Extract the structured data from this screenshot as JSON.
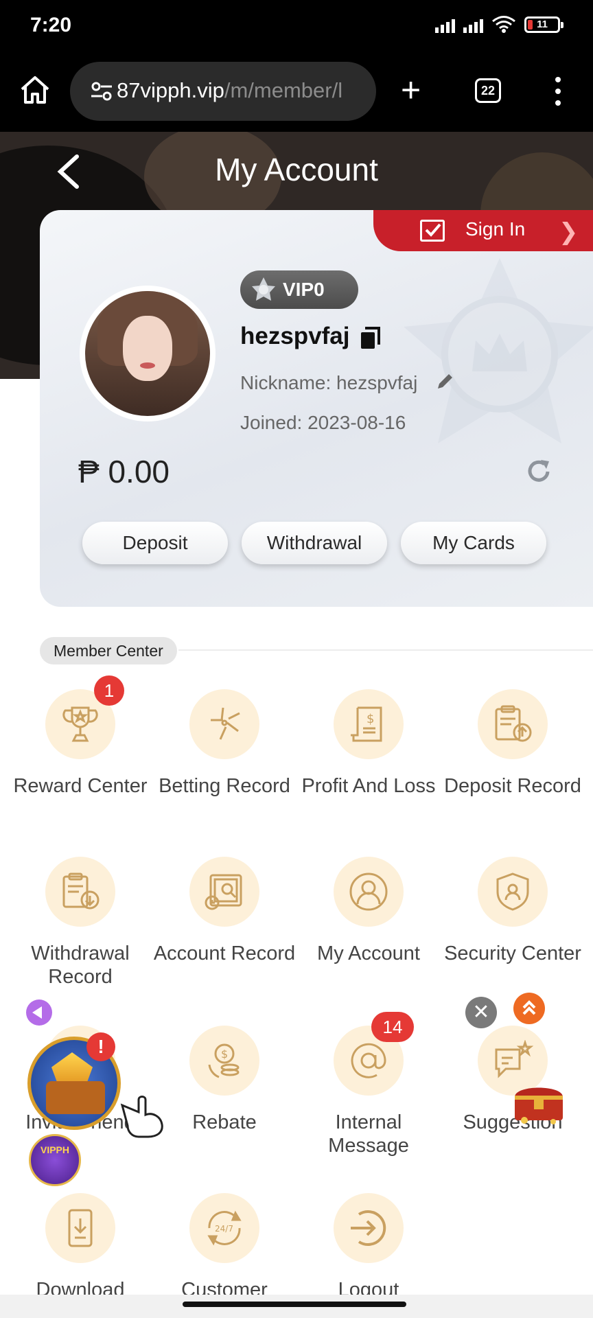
{
  "status_bar": {
    "time": "7:20",
    "battery": "11"
  },
  "browser": {
    "url_domain": "87vipph.vip",
    "url_path": "/m/member/l",
    "tab_count": "22"
  },
  "page": {
    "title": "My Account"
  },
  "account": {
    "sign_in_label": "Sign In",
    "vip_level": "VIP0",
    "username": "hezspvfaj",
    "nickname_label": "Nickname:",
    "nickname": "hezspvfaj",
    "joined_label": "Joined:",
    "joined_date": "2023-08-16",
    "balance": "₱ 0.00",
    "actions": {
      "deposit": "Deposit",
      "withdrawal": "Withdrawal",
      "my_cards": "My Cards"
    }
  },
  "member_center": {
    "title": "Member Center",
    "items": [
      {
        "label": "Reward Center",
        "icon": "trophy-icon",
        "badge": "1"
      },
      {
        "label": "Betting Record",
        "icon": "betting-icon"
      },
      {
        "label": "Profit And Loss",
        "icon": "receipt-icon"
      },
      {
        "label": "Deposit Record",
        "icon": "clipboard-upload-icon"
      },
      {
        "label": "Withdrawal Record",
        "icon": "clipboard-download-icon"
      },
      {
        "label": "Account Record",
        "icon": "ledger-icon"
      },
      {
        "label": "My Account",
        "icon": "user-icon"
      },
      {
        "label": "Security Center",
        "icon": "shield-user-icon"
      },
      {
        "label": "Invite Friend",
        "icon": "invite-icon"
      },
      {
        "label": "Rebate",
        "icon": "coins-icon"
      },
      {
        "label": "Internal Message",
        "icon": "at-icon",
        "badge": "14"
      },
      {
        "label": "Suggestion",
        "icon": "chat-icon"
      },
      {
        "label": "Download",
        "icon": "download-icon"
      },
      {
        "label": "Customer",
        "icon": "support-247-icon"
      },
      {
        "label": "Logout",
        "icon": "logout-icon"
      }
    ]
  },
  "floating": {
    "game_badge": "!",
    "vipph_label": "VIPPH",
    "close_glyph": "✕"
  },
  "colors": {
    "accent": "#c8202a",
    "icon_bg": "#fdf0d9",
    "icon_stroke": "#c9a060",
    "badge": "#e53935"
  }
}
